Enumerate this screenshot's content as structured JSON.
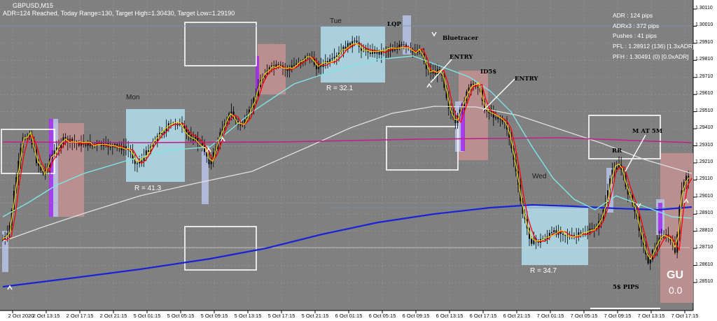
{
  "window": {
    "symbol": "GBPUSD,M15",
    "status_line": "ADR=124 Reached, Today Range=130, Target High=1.30430, Target Low=1.29190"
  },
  "info_panel": [
    "ADR : 124 pips",
    "ADRx3 : 372 pips",
    "Pushes : 41 pips",
    "PFL : 1.28912 (136) [1.3xADR]",
    "PFH : 1.30491 (0) [0.0xADR]"
  ],
  "day_labels": [
    "Mon",
    "Tue",
    "Wed"
  ],
  "range_labels": [
    "R = 41.3",
    "R = 32.1",
    "R = 34.7"
  ],
  "annotations": [
    "LQP",
    "Bluetracer",
    "ENTRY",
    "ID5$",
    "ENTRY",
    "M AT 5M",
    "RR",
    "5$ PIPS"
  ],
  "corner_label": {
    "title": "GU",
    "value": "0.0"
  },
  "price_axis": [
    "1.30110",
    "1.30010",
    "1.29910",
    "1.29810",
    "1.29710",
    "1.29610",
    "1.29510",
    "1.29410",
    "1.29310",
    "1.29210",
    "1.29110",
    "1.29010",
    "1.28910",
    "1.28810",
    "1.28710",
    "1.28610",
    "1.28510"
  ],
  "time_axis": [
    "2 Oct 2020",
    "2 Oct 13:15",
    "2 Oct 17:15",
    "2 Oct 21:15",
    "5 Oct 01:15",
    "5 Oct 05:15",
    "5 Oct 09:15",
    "5 Oct 13:15",
    "5 Oct 17:15",
    "5 Oct 21:15",
    "6 Oct 01:15",
    "6 Oct 05:15",
    "6 Oct 09:15",
    "6 Oct 13:15",
    "6 Oct 17:15",
    "6 Oct 21:15",
    "7 Oct 01:15",
    "7 Oct 05:15",
    "7 Oct 09:15",
    "7 Oct 13:15",
    "7 Oct 17:15"
  ],
  "colors": {
    "background": "#808080",
    "range_box": "#add8e6",
    "supply_zone": "#c09090",
    "candle": "#000000",
    "fast_ma": "#ffd700",
    "slow_ma": "#ff0000",
    "cyan_ma": "#7fe5e5",
    "white_ma": "#e0e0e0",
    "long_ma": "#1a22d6",
    "magenta_line": "#c0208a"
  }
}
